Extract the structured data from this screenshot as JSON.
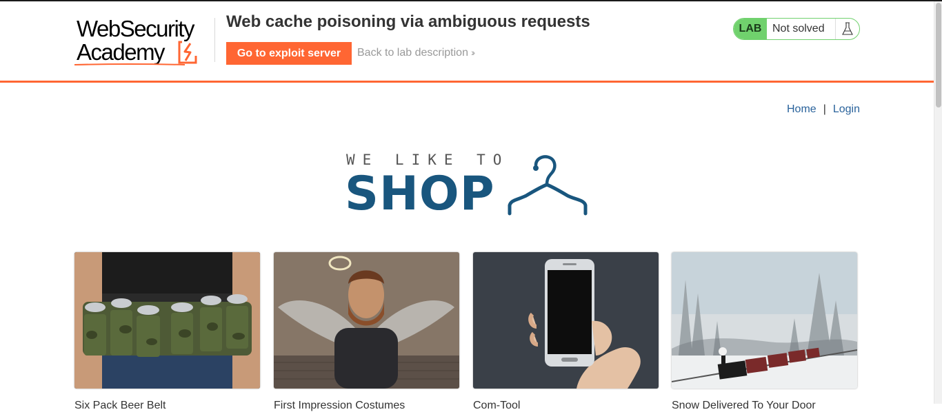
{
  "header": {
    "logo_line1": "WebSecurity",
    "logo_line2": "Academy",
    "lab_title": "Web cache poisoning via ambiguous requests",
    "exploit_button": "Go to exploit server",
    "back_link": "Back to lab description",
    "status_badge": "LAB",
    "status_text": "Not solved"
  },
  "nav": {
    "home": "Home",
    "separator": "|",
    "login": "Login"
  },
  "banner": {
    "small_text": "WE LIKE TO",
    "big_text": "SHOP"
  },
  "products": [
    {
      "name": "Six Pack Beer Belt"
    },
    {
      "name": "First Impression Costumes"
    },
    {
      "name": "Com-Tool"
    },
    {
      "name": "Snow Delivered To Your Door"
    }
  ],
  "colors": {
    "accent": "#ff6633",
    "lab_green": "#70d16d",
    "link_blue": "#29629b",
    "shop_blue": "#19567e"
  }
}
